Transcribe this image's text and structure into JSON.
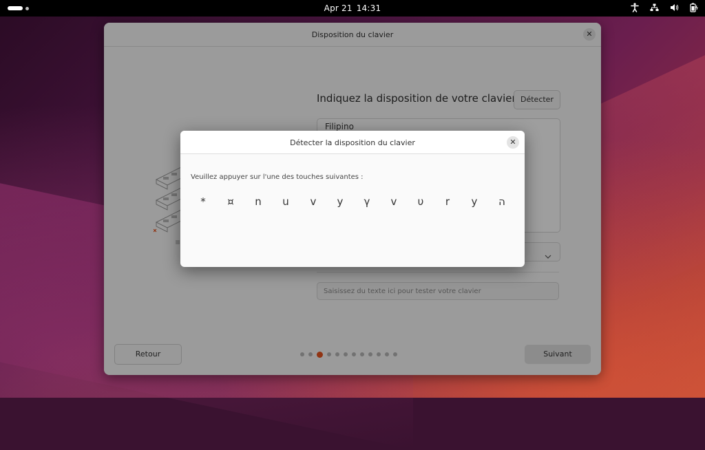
{
  "topbar": {
    "date": "Apr 21",
    "time": "14:31",
    "icons": [
      "accessibility-icon",
      "network-icon",
      "volume-icon",
      "battery-icon"
    ]
  },
  "window": {
    "title": "Disposition du clavier",
    "heading": "Indiquez la disposition de votre clavier :",
    "detect_button": "Détecter",
    "layout_list": [
      "Filipino"
    ],
    "test_input_placeholder": "Saisissez du texte ici pour tester votre clavier",
    "back_button": "Retour",
    "next_button": "Suivant",
    "pager": {
      "total": 12,
      "current": 3
    }
  },
  "dialog": {
    "title": "Détecter la disposition du clavier",
    "prompt": "Veuillez appuyer sur l'une des touches suivantes :",
    "keys": [
      "*",
      "¤",
      "n",
      "u",
      "v",
      "y",
      "γ",
      "v",
      "υ",
      "r",
      "y",
      "ה"
    ]
  },
  "colors": {
    "accent": "#e95420",
    "topbar": "#000000"
  }
}
